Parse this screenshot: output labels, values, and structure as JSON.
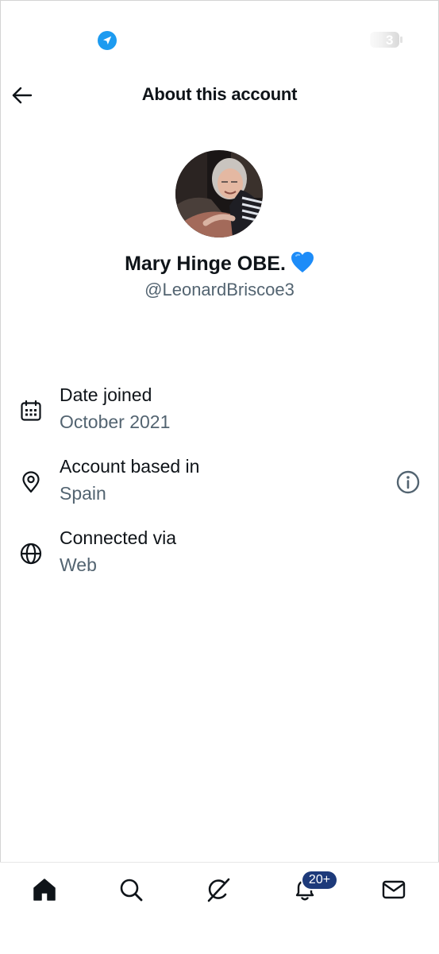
{
  "status_bar": {
    "battery_level_text": "3",
    "location_icon": "location-arrow-icon",
    "accent_color": "#1d9bf0"
  },
  "header": {
    "title": "About this account",
    "back_icon": "arrow-left-icon"
  },
  "profile": {
    "display_name": "Mary Hinge OBE.",
    "emoji": "blue-heart-icon",
    "handle": "@LeonardBriscoe3"
  },
  "info": [
    {
      "label": "Date joined",
      "value": "October 2021",
      "icon": "calendar-icon"
    },
    {
      "label": "Account based in",
      "value": "Spain",
      "icon": "location-pin-icon"
    },
    {
      "label": "Connected via",
      "value": "Web",
      "icon": "globe-icon"
    }
  ],
  "tab_bar": {
    "items": [
      "home-icon",
      "search-icon",
      "grok-icon",
      "notifications-icon",
      "messages-icon"
    ],
    "notifications_badge": "20+"
  }
}
